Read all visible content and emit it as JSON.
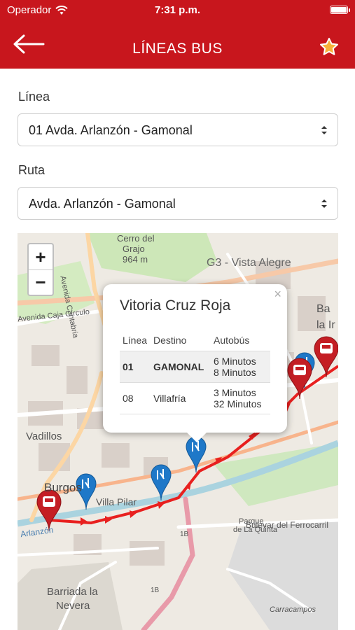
{
  "status": {
    "carrier": "Operador",
    "time": "7:31 p.m."
  },
  "nav": {
    "title": "LÍNEAS BUS"
  },
  "form": {
    "linea_label": "Línea",
    "linea_value": "01 Avda. Arlanzón - Gamonal",
    "ruta_label": "Ruta",
    "ruta_value": "Avda. Arlanzón - Gamonal"
  },
  "map": {
    "zoom_in": "+",
    "zoom_out": "−",
    "labels": {
      "cerro": "Cerro del",
      "grajo": "Grajo",
      "altura": "964 m",
      "g3": "G3 - Vista Alegre",
      "cantabria": "Avenida Cantabria",
      "caja": "Avenida Caja Círculo",
      "vadillos": "Vadillos",
      "burgos": "Burgos",
      "villa": "Villa Pilar",
      "parque": "Parque",
      "laquinta": "de La Quinta",
      "bulevar": "Bulevar del Ferrocarril",
      "arlanzon": "Arlanzón",
      "barriada": "Barriada la",
      "nevera": "Nevera",
      "carracampos": "Carracampos",
      "b1": "Ba",
      "b2": "la Ir",
      "r1b_a": "1B",
      "r1b_b": "1B"
    }
  },
  "popup": {
    "close": "×",
    "title": "Vitoria Cruz Roja",
    "headers": [
      "Línea",
      "Destino",
      "Autobús"
    ],
    "rows": [
      {
        "linea": "01",
        "destino": "GAMONAL",
        "t1": "6 Minutos",
        "t2": "8 Minutos"
      },
      {
        "linea": "08",
        "destino": "Villafría",
        "t1": "3 Minutos",
        "t2": "32 Minutos"
      }
    ]
  },
  "colors": {
    "brand": "#c8161d",
    "route": "#e8201f",
    "stop_pin": "#1f78c8",
    "bus_pin": "#c41e24"
  },
  "icons": {
    "back": "arrow-left-icon",
    "favorite": "star-icon",
    "wifi": "wifi-icon",
    "battery": "battery-icon",
    "caret": "select-caret-icon"
  }
}
